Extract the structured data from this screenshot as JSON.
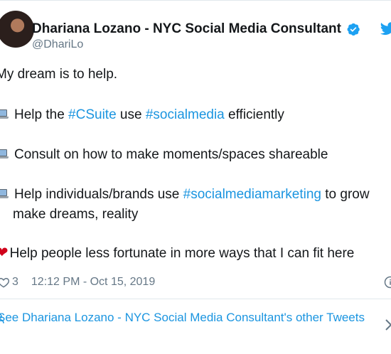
{
  "author": {
    "display_name": "Dhariana Lozano - NYC Social Media Consultant",
    "handle": "@DhariLo",
    "verified": true
  },
  "tweet": {
    "lines": [
      {
        "icon": "none",
        "parts": [
          {
            "text": "My dream is to help.",
            "type": "text"
          }
        ]
      },
      {
        "icon": "laptop-icon",
        "parts": [
          {
            "text": "Help the ",
            "type": "text"
          },
          {
            "text": "#CSuite",
            "type": "hashtag"
          },
          {
            "text": " use ",
            "type": "text"
          },
          {
            "text": "#socialmedia",
            "type": "hashtag"
          },
          {
            "text": " efficiently",
            "type": "text"
          }
        ]
      },
      {
        "icon": "laptop-icon",
        "parts": [
          {
            "text": "Consult on how to make moments/spaces shareable",
            "type": "text"
          }
        ]
      },
      {
        "icon": "laptop-icon",
        "parts": [
          {
            "text": "Help individuals/brands use ",
            "type": "text"
          },
          {
            "text": "#socialmediamarketing",
            "type": "hashtag"
          },
          {
            "text": " to grow",
            "type": "text"
          }
        ]
      },
      {
        "icon": "none",
        "parts": [
          {
            "text": "make dreams, reality",
            "type": "text"
          }
        ]
      },
      {
        "icon": "heart-icon",
        "parts": [
          {
            "text": "Help people less fortunate in more ways that I can fit here",
            "type": "text"
          }
        ]
      }
    ]
  },
  "meta": {
    "like_count": "3",
    "timestamp": "12:12 PM - Oct 15, 2019"
  },
  "see_more": {
    "text": "See Dhariana Lozano - NYC Social Media Consultant's other Tweets"
  },
  "colors": {
    "link": "#1b95e0",
    "text": "#14171a",
    "muted": "#657786",
    "heart": "#d0021b"
  }
}
